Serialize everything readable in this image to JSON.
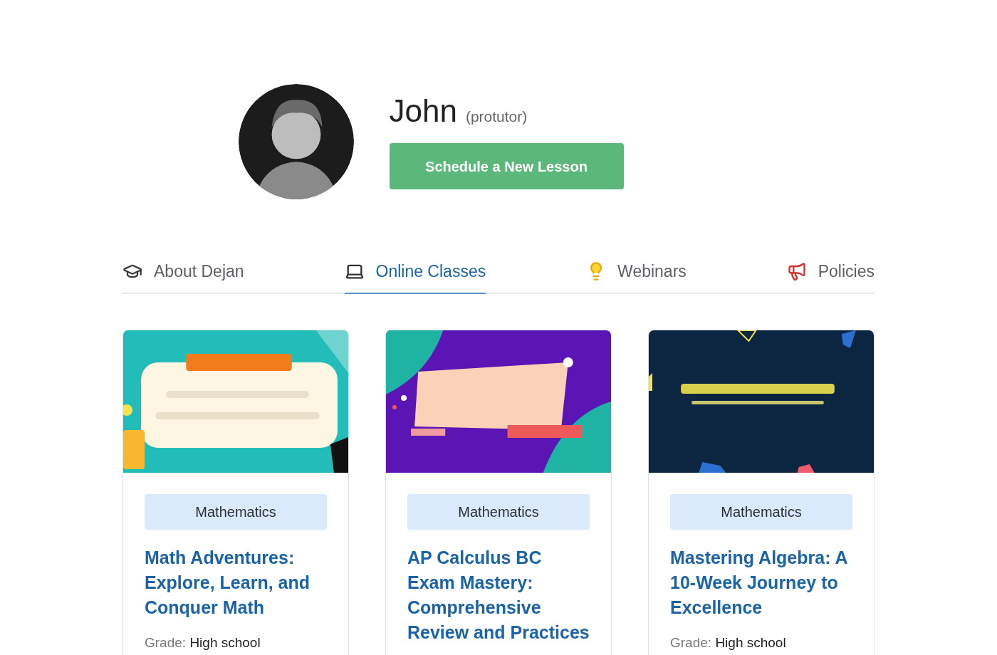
{
  "profile": {
    "name": "John",
    "role": "(protutor)",
    "schedule_button": "Schedule a New Lesson"
  },
  "tabs": [
    {
      "label": "About Dejan",
      "kind": "cap",
      "selected": false
    },
    {
      "label": "Online Classes",
      "kind": "laptop",
      "selected": true
    },
    {
      "label": "Webinars",
      "kind": "bulb",
      "selected": false
    },
    {
      "label": "Policies",
      "kind": "megaphone",
      "selected": false
    }
  ],
  "classes": [
    {
      "kind": "teal",
      "subject": "Mathematics",
      "title": "Math Adventures: Explore, Learn, and Conquer Math",
      "grade_label": "Grade:",
      "grade": "High school"
    },
    {
      "kind": "purple",
      "subject": "Mathematics",
      "title": "AP Calculus BC Exam Mastery: Comprehensive Review and Practices"
    },
    {
      "kind": "navy",
      "subject": "Mathematics",
      "title": "Mastering Algebra: A 10-Week Journey to Excellence",
      "grade_label": "Grade:",
      "grade": "High school"
    }
  ]
}
